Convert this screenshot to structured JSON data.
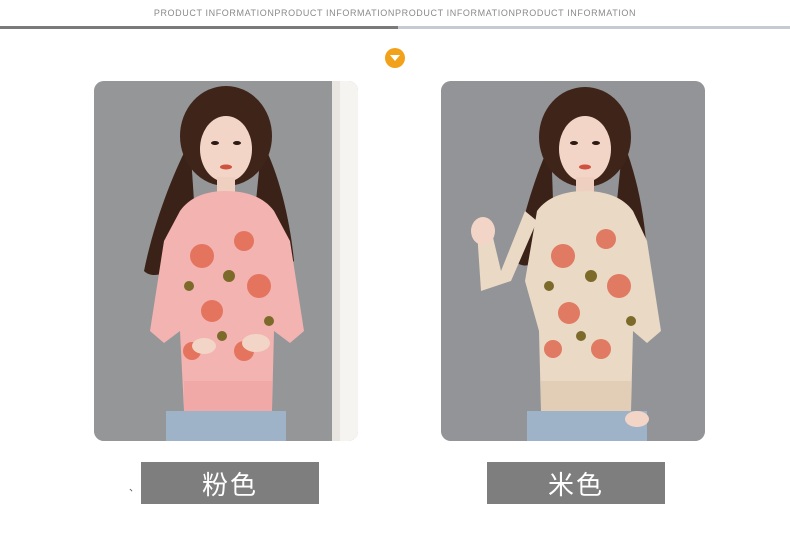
{
  "header": {
    "text": "PRODUCT INFORMATIONPRODUCT INFORMATIONPRODUCT INFORMATIONPRODUCT INFORMATION"
  },
  "badge": {
    "icon": "chevron-down-icon",
    "color": "#f2a21a"
  },
  "products": [
    {
      "color_name": "粉色",
      "sweater_color": "#f2b3b1",
      "image": "model-pink-sweater"
    },
    {
      "color_name": "米色",
      "sweater_color": "#ead9c5",
      "image": "model-beige-sweater"
    }
  ],
  "mark": "、"
}
